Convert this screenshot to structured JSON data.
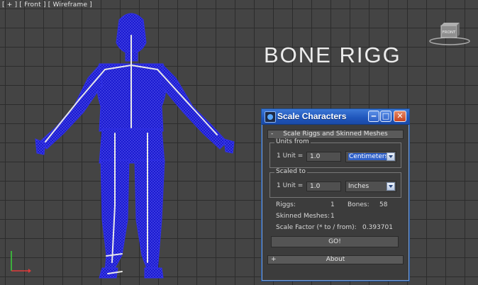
{
  "viewport": {
    "label": "[ + ] [ Front ] [ Wireframe ]",
    "title": "BONE RIGG",
    "viewcube_label": "FRONT"
  },
  "dialog": {
    "title": "Scale Characters",
    "icon": "maxscript-icon",
    "buttons": {
      "minimize": "minimize-icon",
      "maximize": "maximize-icon",
      "close": "close-icon"
    },
    "rollout": {
      "sign": "-",
      "title": "Scale Riggs and Skinned Meshes",
      "units_from": {
        "label": "Units from",
        "unit_label": "1 Unit =",
        "value": "1.0",
        "unit": "Centimeters"
      },
      "scaled_to": {
        "label": "Scaled to",
        "unit_label": "1 Unit =",
        "value": "1.0",
        "unit": "Inches"
      },
      "stats": {
        "riggs_label": "Riggs:",
        "riggs": "1",
        "bones_label": "Bones:",
        "bones": "58",
        "meshes_label": "Skinned Meshes:",
        "meshes": "1",
        "factor_label": "Scale Factor (* to / from):",
        "factor": "0.393701"
      },
      "go_label": "GO!"
    },
    "about": {
      "sign": "+",
      "title": "About"
    }
  },
  "colors": {
    "viewport_bg": "#444444",
    "grid": "#2c2c2c",
    "mesh": "#1a1ad0",
    "titlebar": "#2a62c9",
    "close_btn": "#d0542c"
  }
}
